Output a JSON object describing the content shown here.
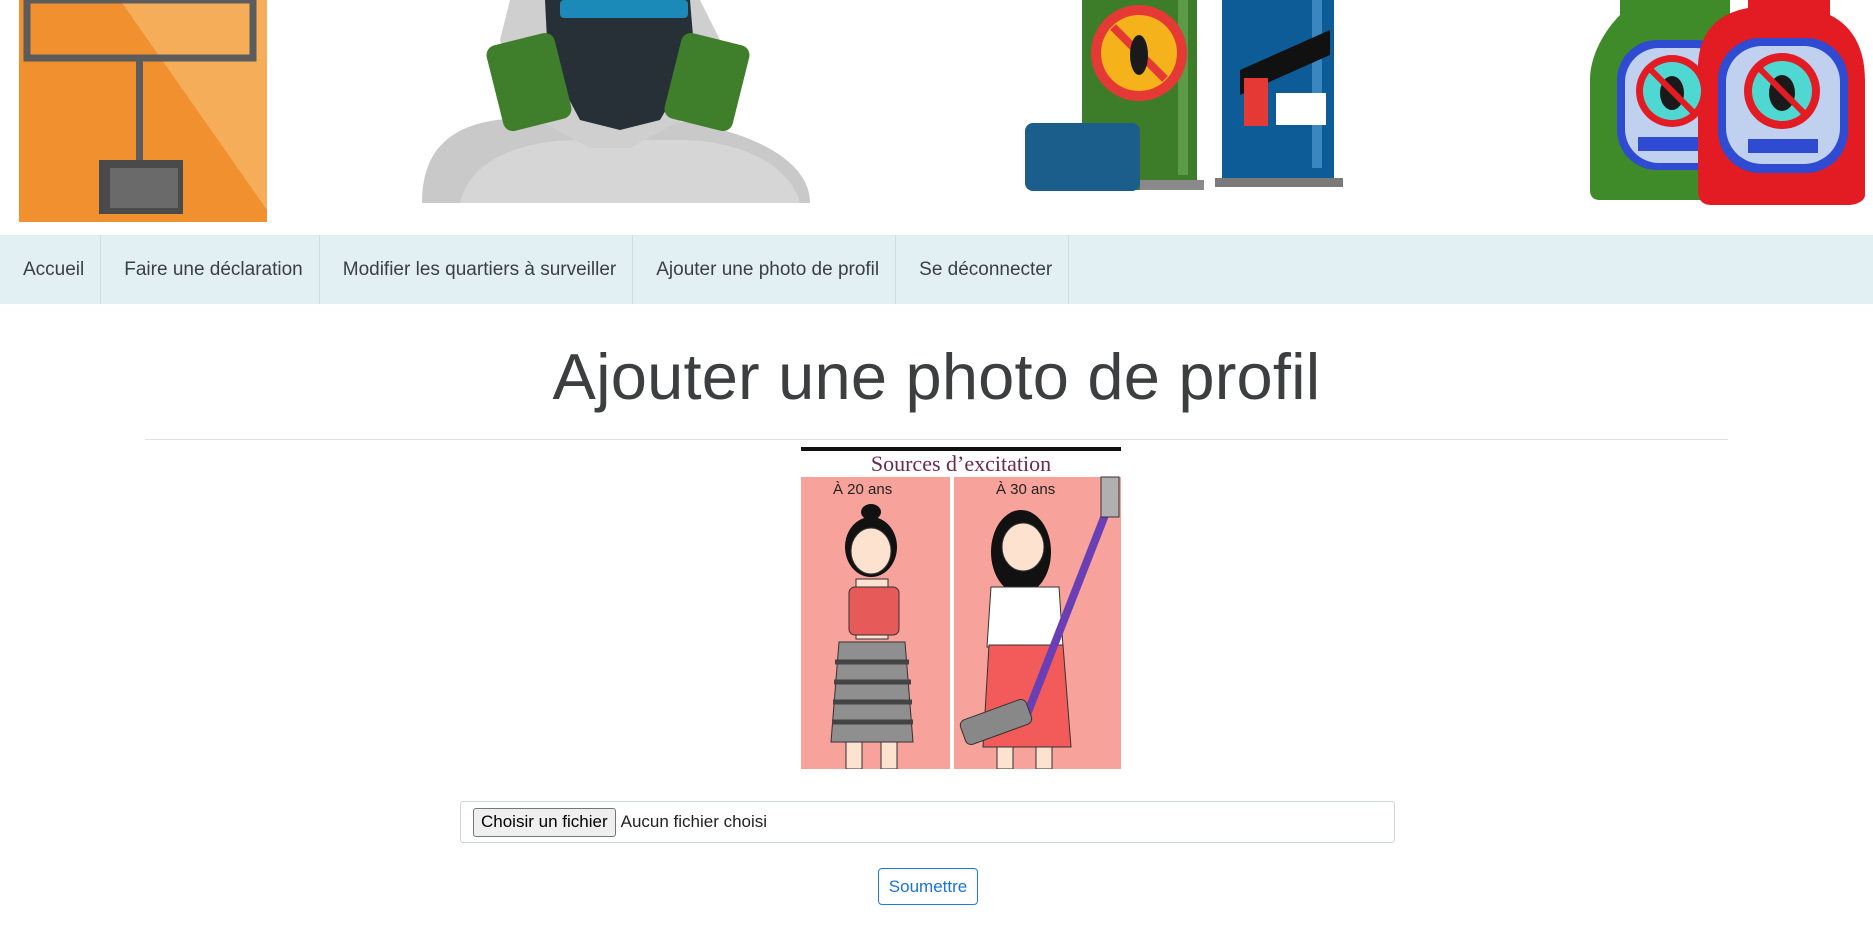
{
  "nav": {
    "items": [
      {
        "label": "Accueil"
      },
      {
        "label": "Faire une déclaration"
      },
      {
        "label": "Modifier les quartiers à surveiller"
      },
      {
        "label": "Ajouter une photo de profil"
      },
      {
        "label": "Se déconnecter"
      }
    ]
  },
  "main": {
    "title": "Ajouter une photo de profil",
    "preview": {
      "caption_title": "Sources d’excitation",
      "left_label": "À 20 ans",
      "right_label": "À 30 ans"
    },
    "file_input": {
      "button_label": "Choisir un fichier",
      "status": "Aucun fichier choisi"
    },
    "submit_label": "Soumettre"
  },
  "colors": {
    "navbar_bg": "#e3f0f3",
    "accent": "#1e7be0",
    "title": "#3c3e40"
  },
  "banner": {
    "icons": [
      "extractor-fan-icon",
      "gas-mask-suit-icon",
      "insect-spray-cans-icon",
      "bug-spray-bottles-icon"
    ]
  }
}
